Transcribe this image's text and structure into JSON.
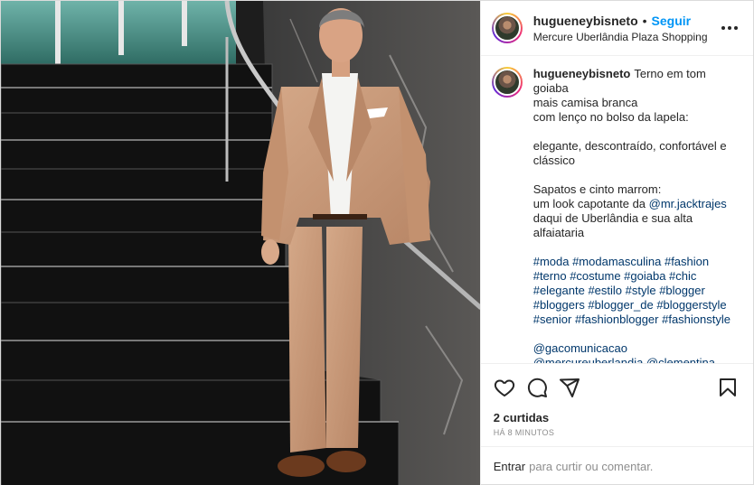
{
  "header": {
    "username": "hugueneybisneto",
    "separator": "•",
    "follow_label": "Seguir",
    "location": "Mercure Uberlândia Plaza Shopping",
    "more_icon": "more-horizontal-icon"
  },
  "caption": {
    "username": "hugueneybisneto",
    "first_line": "Terno em tom",
    "lines": [
      "goiaba",
      "mais camisa branca",
      "com lenço no bolso da lapela:",
      "",
      "elegante, descontraído, confortável e",
      "clássico",
      "",
      "Sapatos e cinto marrom:"
    ],
    "mention_line_prefix": "um look capotante da ",
    "mention_1": "@mr.jacktrajes",
    "lines_after": [
      "daqui de Uberlândia e sua alta",
      "alfaiataria"
    ],
    "hashtag_lines": [
      "#moda #modamasculina #fashion",
      "#terno #costume #goiaba #chic",
      "#elegante #estilo #style #blogger",
      "#bloggers #blogger_de #bloggerstyle",
      "#senior #fashionblogger #fashionstyle"
    ],
    "mention_lines": [
      "@gacomunicacao",
      "@mercureuberlandia @clementina"
    ]
  },
  "actions": {
    "like_icon": "heart-icon",
    "comment_icon": "comment-icon",
    "share_icon": "send-icon",
    "save_icon": "bookmark-icon"
  },
  "likes_text": "2 curtidas",
  "time_text": "HÁ 8 MINUTOS",
  "login": {
    "enter_label": "Entrar",
    "rest_text": "para curtir ou comentar."
  },
  "colors": {
    "accent_blue": "#0095f6",
    "link_blue": "#00376b",
    "suit": "#c8987a"
  }
}
